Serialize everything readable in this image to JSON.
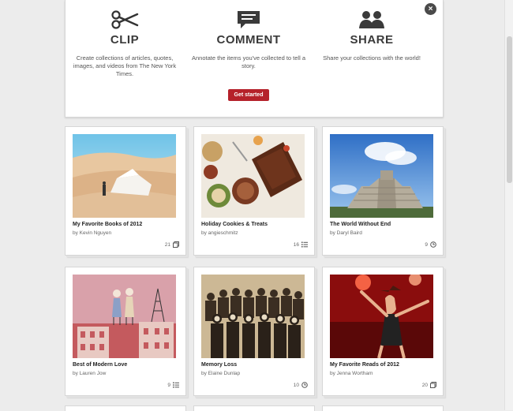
{
  "intro": {
    "features": [
      {
        "icon": "scissors-icon",
        "title": "CLIP",
        "desc": "Create collections of articles, quotes, images, and videos from The New York Times."
      },
      {
        "icon": "speech-bubble-icon",
        "title": "COMMENT",
        "desc": "Annotate the items you've collected to tell a story."
      },
      {
        "icon": "people-icon",
        "title": "SHARE",
        "desc": "Share your collections with the world!"
      }
    ],
    "cta": "Get started",
    "close": "×"
  },
  "collections": [
    {
      "title": "My Favorite Books of 2012",
      "author": "by Kevin Nguyen",
      "count": "21",
      "count_icon": "clip-stack-icon"
    },
    {
      "title": "Holiday Cookies & Treats",
      "author": "by angieschmitz",
      "count": "16",
      "count_icon": "list-icon"
    },
    {
      "title": "The World Without End",
      "author": "by Daryl Baird",
      "count": "9",
      "count_icon": "clock-icon"
    },
    {
      "title": "Best of Modern Love",
      "author": "by Lauren Jow",
      "count": "9",
      "count_icon": "list-icon"
    },
    {
      "title": "Memory Loss",
      "author": "by Elaine Dunlap",
      "count": "10",
      "count_icon": "clock-icon"
    },
    {
      "title": "My Favorite Reads of 2012",
      "author": "by Jenna Wortham",
      "count": "20",
      "count_icon": "clip-stack-icon"
    }
  ],
  "colors": {
    "accent": "#b5212a",
    "background": "#ececec"
  }
}
